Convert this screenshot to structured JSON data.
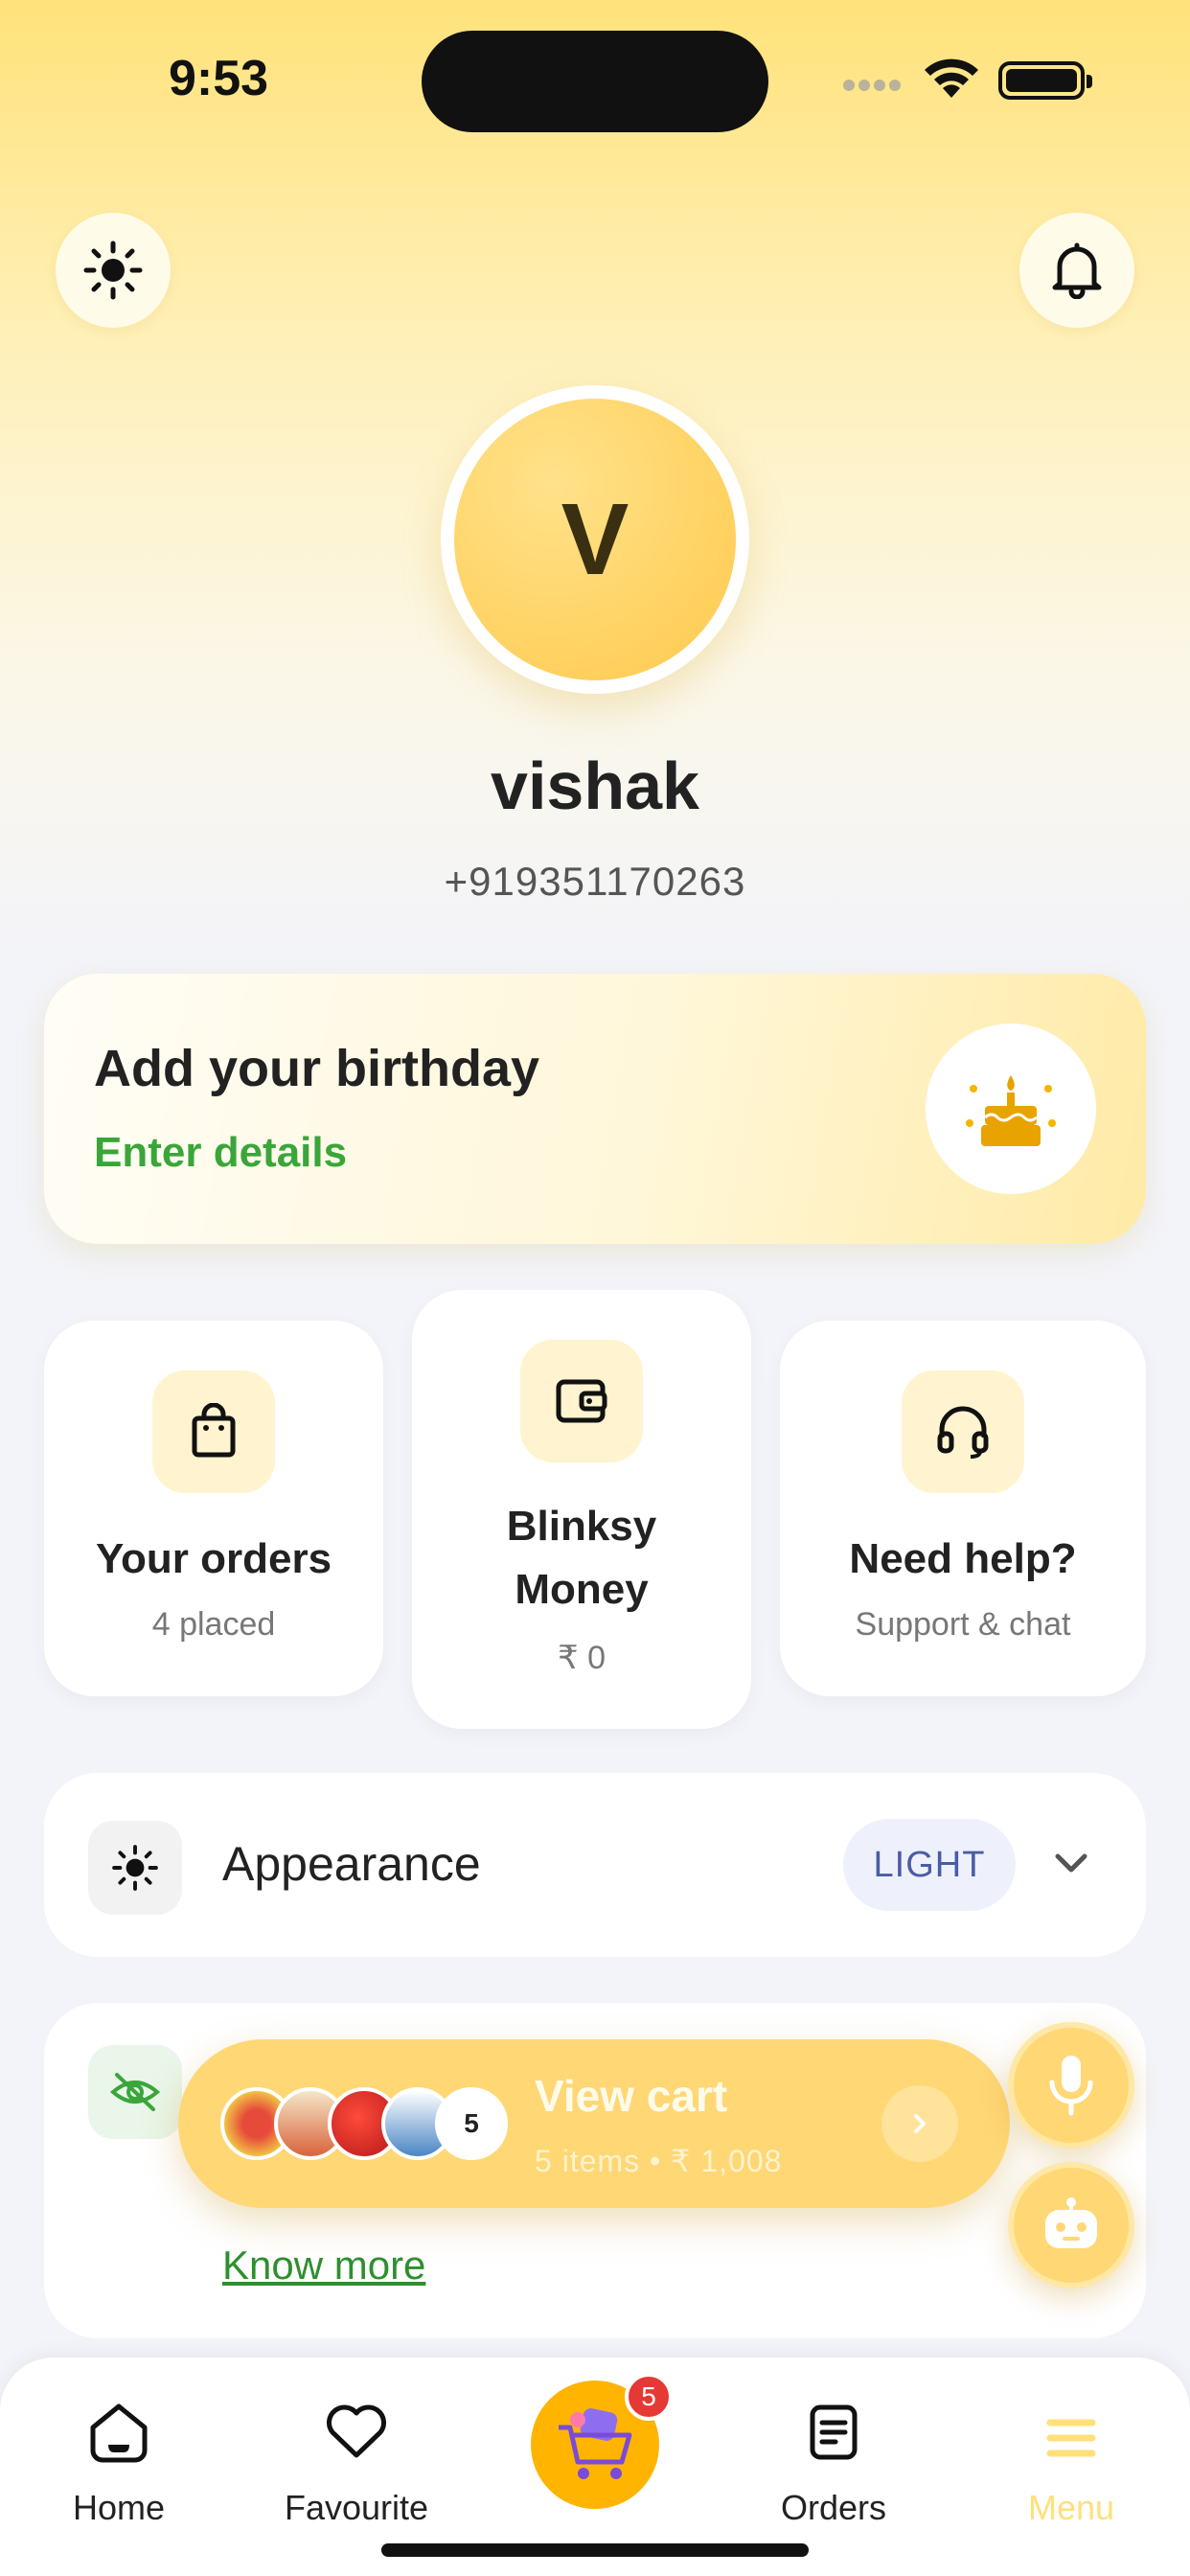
{
  "status_bar": {
    "time": "9:53"
  },
  "header": {
    "theme_icon": "sun-icon",
    "notification_icon": "bell-icon"
  },
  "profile": {
    "initial": "V",
    "name": "vishak",
    "phone": "+919351170263"
  },
  "birthday_card": {
    "title": "Add your birthday",
    "link": "Enter details",
    "icon": "cake-icon"
  },
  "tiles": [
    {
      "title": "Your orders",
      "subtitle": "4 placed",
      "icon": "shopping-bag-icon"
    },
    {
      "title_line1": "Blinksy",
      "title_line2": "Money",
      "subtitle": "₹ 0",
      "icon": "wallet-icon"
    },
    {
      "title": "Need help?",
      "subtitle": "Support & chat",
      "icon": "headset-icon"
    }
  ],
  "appearance": {
    "label": "Appearance",
    "value": "LIGHT",
    "icon": "sun-icon"
  },
  "privacy_card": {
    "icon": "eye-off-icon",
    "link": "Know more"
  },
  "cart": {
    "title": "View cart",
    "summary": "5 items • ₹ 1,008",
    "count": "5"
  },
  "bottom_nav": {
    "items": [
      {
        "label": "Home",
        "icon": "home-icon"
      },
      {
        "label": "Favourite",
        "icon": "heart-icon"
      },
      {
        "label": "Orders",
        "icon": "receipt-icon"
      },
      {
        "label": "Menu",
        "icon": "menu-icon"
      }
    ],
    "cart_badge": "5"
  },
  "colors": {
    "accent": "#ffc94d",
    "link_green": "#3aa63a",
    "menu_active": "#ffe07a"
  }
}
